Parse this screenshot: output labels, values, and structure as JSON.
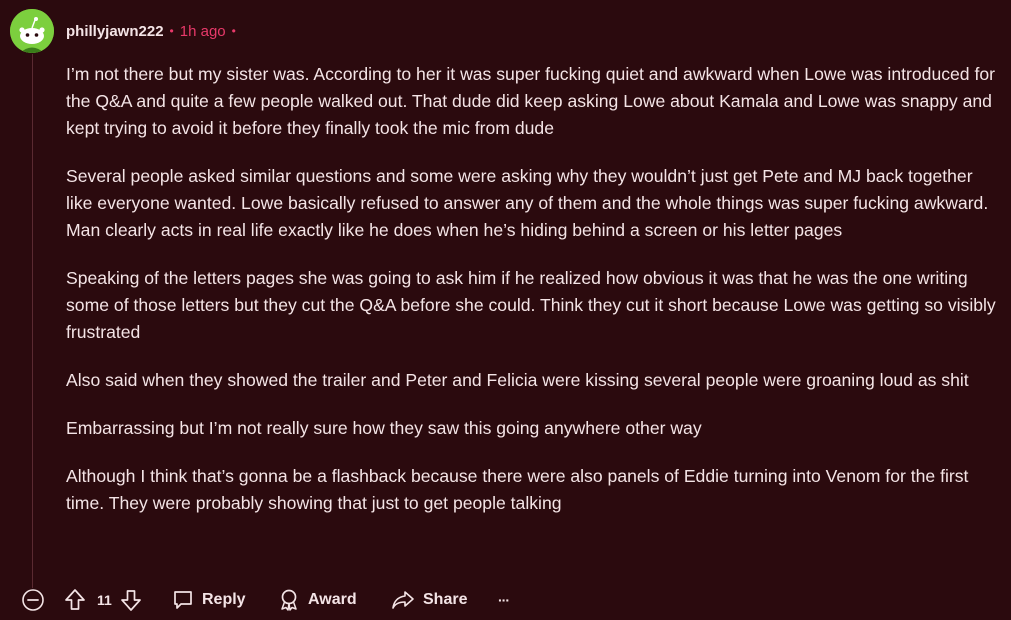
{
  "comment": {
    "author": "phillyjawn222",
    "dot_before": "•",
    "time": "1h ago",
    "dot_after": "•",
    "paragraphs": [
      "I’m not there but my sister was. According to her it was super fucking quiet and awkward when Lowe was introduced for the Q&A and quite a few people walked out. That dude did keep asking Lowe about Kamala and Lowe was snappy and kept trying to avoid it before they finally took the mic from dude",
      "Several people asked similar questions and some were asking why they wouldn’t just get Pete and MJ back together like everyone wanted. Lowe basically refused to answer any of them and the whole things was super fucking awkward. Man clearly acts in real life exactly like he does when he’s hiding behind a screen or his letter pages",
      "Speaking of the letters pages she was going to ask him if he realized how obvious it was that he was the one writing some of those letters but they cut the Q&A before she could. Think they cut it short because Lowe was getting so visibly frustrated",
      "Also said when they showed the trailer and Peter and Felicia were kissing several people were groaning loud as shit",
      "Embarrassing but I’m not really sure how they saw this going anywhere other way",
      "Although I think that’s gonna be a flashback because there were also panels of Eddie turning into Venom for the first time. They were probably showing that just to get people talking"
    ]
  },
  "actions": {
    "vote_count": "11",
    "reply_label": "Reply",
    "award_label": "Award",
    "share_label": "Share",
    "more_label": "···"
  },
  "icons": {
    "collapse": "collapse-icon",
    "upvote": "upvote-icon",
    "downvote": "downvote-icon",
    "reply": "reply-icon",
    "award": "award-icon",
    "share": "share-icon",
    "more": "more-icon"
  },
  "colors": {
    "background": "#2b0a0e",
    "text": "#f4e4e6",
    "accent": "#e8396a",
    "avatar": "#7ccf3e"
  }
}
